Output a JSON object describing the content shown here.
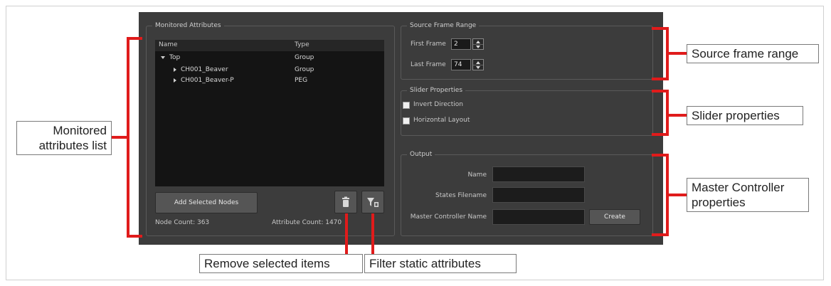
{
  "monitored": {
    "title": "Monitored Attributes",
    "col_name": "Name",
    "col_type": "Type",
    "rows": [
      {
        "name": "Top",
        "type": "Group"
      },
      {
        "name": "CH001_Beaver",
        "type": "Group"
      },
      {
        "name": "CH001_Beaver-P",
        "type": "PEG"
      }
    ],
    "add_button": "Add Selected Nodes",
    "node_count": "Node Count: 363",
    "attribute_count": "Attribute Count: 1470",
    "delete_icon": "trash-icon",
    "filter_icon": "filter-icon"
  },
  "source_frame_range": {
    "title": "Source Frame Range",
    "first_label": "First Frame",
    "first_value": "2",
    "last_label": "Last Frame",
    "last_value": "74"
  },
  "slider_properties": {
    "title": "Slider Properties",
    "invert_label": "Invert Direction",
    "horizontal_label": "Horizontal Layout"
  },
  "output": {
    "title": "Output",
    "name_label": "Name",
    "states_label": "States Filename",
    "mc_label": "Master Controller Name",
    "create_button": "Create"
  },
  "callouts": {
    "monitored_line1": "Monitored",
    "monitored_line2": "attributes list",
    "source": "Source frame range",
    "slider": "Slider properties",
    "master_line1": "Master Controller",
    "master_line2": "properties",
    "remove": "Remove selected items",
    "filter": "Filter static attributes"
  },
  "colors": {
    "annotation": "#e01b1b",
    "panel": "#3c3c3c"
  }
}
